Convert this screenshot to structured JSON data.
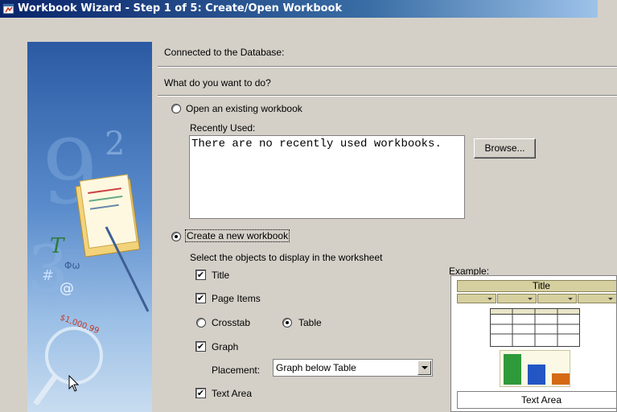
{
  "window": {
    "title": "Workbook Wizard - Step 1 of 5: Create/Open Workbook"
  },
  "status": {
    "connected_label": "Connected to the Database:"
  },
  "question": "What do you want to do?",
  "open_option": {
    "label": "Open an existing workbook",
    "selected": false,
    "recently_used_label": "Recently Used:",
    "recent_list_message": "There are no recently used workbooks.",
    "browse_label": "Browse..."
  },
  "create_option": {
    "label": "Create a new workbook",
    "selected": true,
    "objects_label": "Select the objects to display in the worksheet",
    "objects": {
      "title": {
        "label": "Title",
        "checked": true
      },
      "page_items": {
        "label": "Page Items",
        "checked": true
      },
      "crosstab": {
        "label": "Crosstab",
        "selected": false
      },
      "table": {
        "label": "Table",
        "selected": true
      },
      "graph": {
        "label": "Graph",
        "checked": true
      },
      "placement_label": "Placement:",
      "placement_value": "Graph below Table",
      "text_area": {
        "label": "Text Area",
        "checked": true
      }
    }
  },
  "example": {
    "label": "Example:",
    "title_text": "Title",
    "text_area_text": "Text Area",
    "bar_colors": [
      "#2e9a3a",
      "#2356c4",
      "#d46a14"
    ]
  },
  "icons": {
    "title_icon": "wizard-window-icon",
    "check_mark": "✔"
  }
}
